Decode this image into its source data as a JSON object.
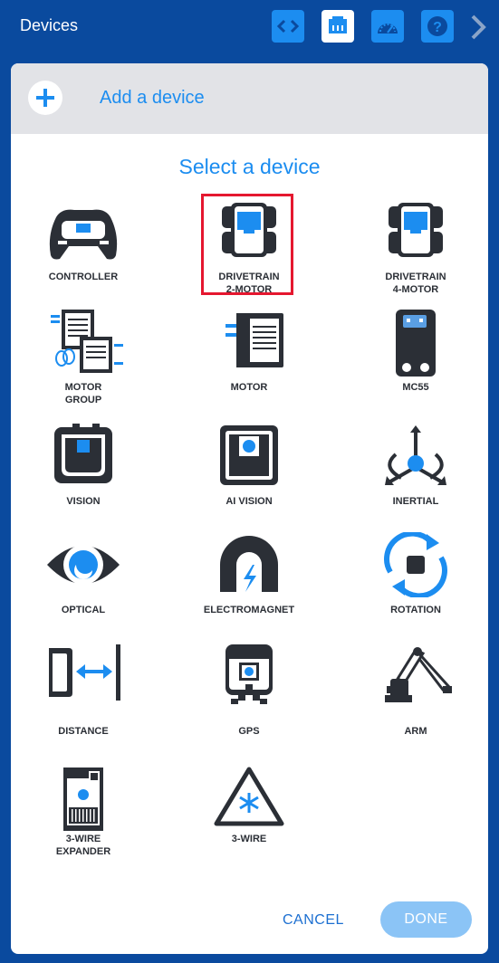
{
  "header": {
    "title": "Devices"
  },
  "add": {
    "label": "Add a device"
  },
  "heading": "Select a device",
  "devices": {
    "controller": "CONTROLLER",
    "drivetrain2a": "DRIVETRAIN",
    "drivetrain2b": "2-MOTOR",
    "drivetrain4a": "DRIVETRAIN",
    "drivetrain4b": "4-MOTOR",
    "motorgroupa": "MOTOR",
    "motorgroupb": "GROUP",
    "motor": "MOTOR",
    "mc55": "MC55",
    "vision": "VISION",
    "aivision": "AI VISION",
    "inertial": "INERTIAL",
    "optical": "OPTICAL",
    "electromagnet": "ELECTROMAGNET",
    "rotation": "ROTATION",
    "distance": "DISTANCE",
    "gps": "GPS",
    "arm": "ARM",
    "expandera": "3-WIRE",
    "expanderb": "EXPANDER",
    "threewire": "3-WIRE"
  },
  "footer": {
    "cancel": "CANCEL",
    "done": "DONE"
  },
  "colors": {
    "header_bg": "#0a4a9e",
    "accent": "#1c8df0",
    "icon_dark": "#2b2f36",
    "selected_border": "#e5172f",
    "done_bg": "#8bc4f6"
  }
}
